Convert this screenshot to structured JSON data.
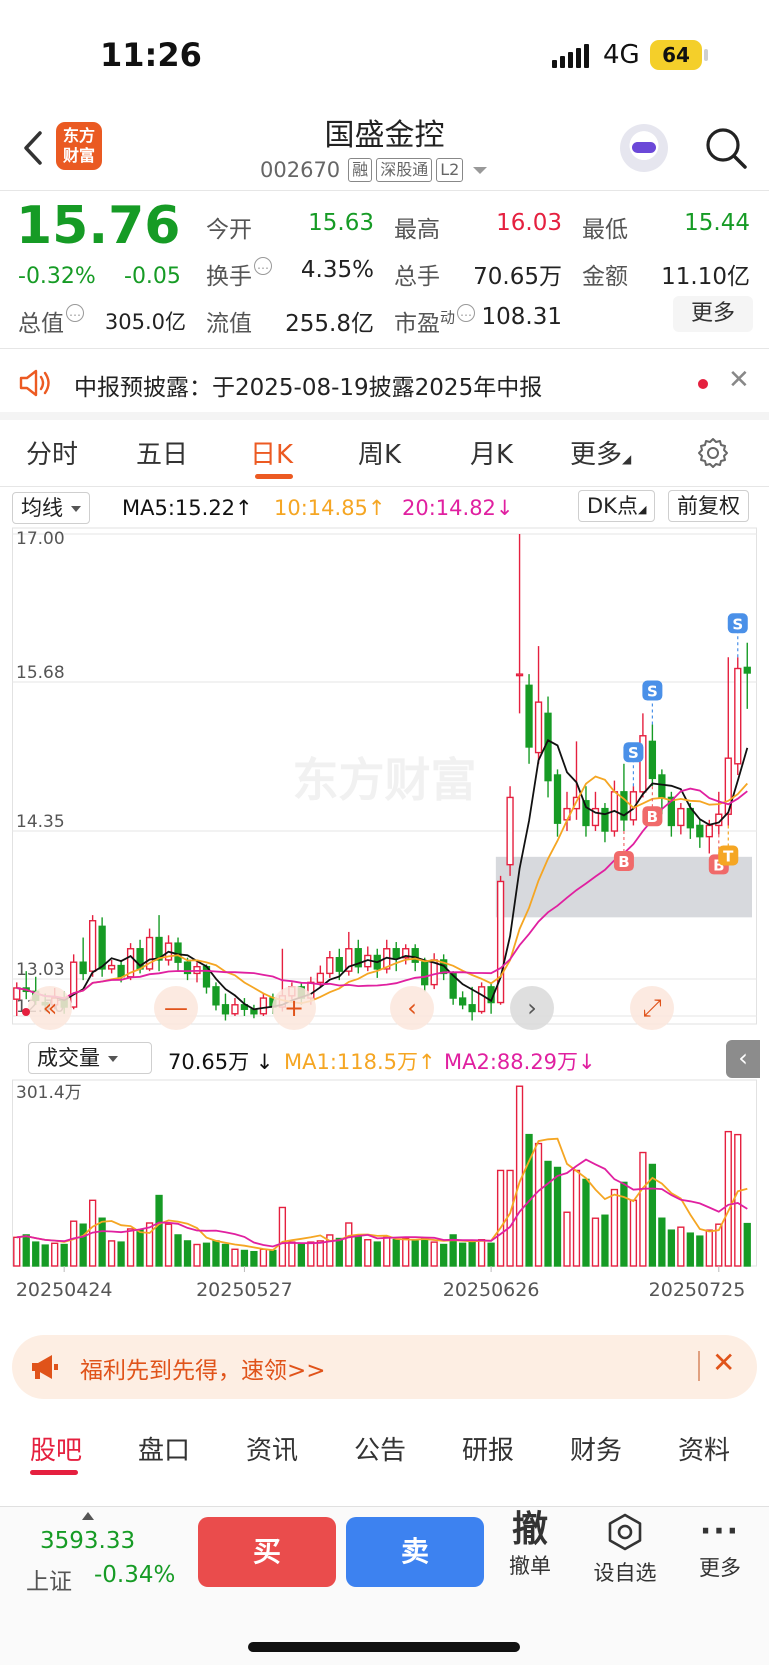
{
  "status": {
    "time": "11:26",
    "network": "4G",
    "battery": "64"
  },
  "header": {
    "logo": "东方\n财富",
    "stock_name": "国盛金控",
    "stock_code": "002670",
    "tags": [
      "融",
      "深股通",
      "L2"
    ]
  },
  "quote": {
    "price": "15.76",
    "change_pct": "-0.32%",
    "change_abs": "-0.05",
    "open_label": "今开",
    "open": "15.63",
    "high_label": "最高",
    "high": "16.03",
    "low_label": "最低",
    "low": "15.44",
    "turnover_label": "换手",
    "turnover": "4.35%",
    "volume_label": "总手",
    "volume": "70.65万",
    "amount_label": "金额",
    "amount": "11.10亿",
    "mktcap_label": "总值",
    "mktcap": "305.0亿",
    "float_label": "流值",
    "float_cap": "255.8亿",
    "pe_label": "市盈",
    "pe_sup": "动",
    "pe": "108.31",
    "more": "更多"
  },
  "notice": {
    "text": "中报预披露：于2025-08-19披露2025年中报"
  },
  "tabs": [
    "分时",
    "五日",
    "日K",
    "周K",
    "月K",
    "更多"
  ],
  "active_tab": "日K",
  "chart_toolbar": {
    "indicator": "均线",
    "ma5": "MA5:15.22",
    "ma10": "10:14.85",
    "ma20": "20:14.82",
    "dk": "DK点",
    "adjust": "前复权"
  },
  "volume_toolbar": {
    "indicator": "成交量",
    "vol": "70.65万",
    "ma1": "MA1:118.5万",
    "ma2": "MA2:88.29万"
  },
  "colors": {
    "up": "#e5203f",
    "down": "#169b25",
    "ma5": "#111111",
    "ma10": "#f5a623",
    "ma20": "#e020a0",
    "accent": "#ec5a22"
  },
  "chart_data": {
    "type": "candlestick",
    "price_axis": {
      "ylim": [
        12.7,
        17.0
      ],
      "ticks": [
        "17.00",
        "15.68",
        "14.35",
        "13.03",
        "12.70"
      ]
    },
    "volume_axis": {
      "max_label": "301.4万",
      "ylim": [
        0,
        301.4
      ]
    },
    "x_labels": [
      "20250424",
      "20250527",
      "20250626",
      "20250725"
    ],
    "candles": [
      [
        12.85,
        12.95,
        12.7,
        13.0,
        48
      ],
      [
        12.95,
        12.92,
        12.85,
        13.1,
        52
      ],
      [
        12.92,
        12.84,
        12.8,
        13.05,
        40
      ],
      [
        12.82,
        12.8,
        12.74,
        12.9,
        35
      ],
      [
        12.8,
        12.86,
        12.76,
        12.95,
        38
      ],
      [
        12.86,
        12.78,
        12.72,
        12.92,
        36
      ],
      [
        12.78,
        13.18,
        12.76,
        13.25,
        75
      ],
      [
        13.18,
        13.08,
        13.02,
        13.4,
        70
      ],
      [
        13.1,
        13.55,
        13.05,
        13.6,
        110
      ],
      [
        13.5,
        13.12,
        13.05,
        13.58,
        80
      ],
      [
        13.12,
        13.15,
        13.08,
        13.2,
        42
      ],
      [
        13.15,
        13.05,
        13.0,
        13.2,
        40
      ],
      [
        13.05,
        13.3,
        13.02,
        13.35,
        62
      ],
      [
        13.3,
        13.12,
        13.08,
        13.38,
        60
      ],
      [
        13.12,
        13.4,
        13.1,
        13.48,
        72
      ],
      [
        13.4,
        13.2,
        13.1,
        13.6,
        118
      ],
      [
        13.2,
        13.35,
        13.15,
        13.42,
        70
      ],
      [
        13.35,
        13.18,
        13.1,
        13.4,
        52
      ],
      [
        13.18,
        13.08,
        13.02,
        13.22,
        42
      ],
      [
        13.08,
        13.14,
        13.0,
        13.18,
        36
      ],
      [
        13.14,
        12.96,
        12.9,
        13.16,
        38
      ],
      [
        12.96,
        12.8,
        12.75,
        13.0,
        42
      ],
      [
        12.8,
        12.72,
        12.66,
        12.9,
        36
      ],
      [
        12.72,
        12.8,
        12.7,
        12.86,
        28
      ],
      [
        12.8,
        12.76,
        12.7,
        12.86,
        26
      ],
      [
        12.76,
        12.72,
        12.68,
        12.8,
        24
      ],
      [
        12.72,
        12.86,
        12.7,
        12.9,
        28
      ],
      [
        12.86,
        12.78,
        12.72,
        12.9,
        26
      ],
      [
        12.78,
        12.88,
        12.74,
        13.3,
        98
      ],
      [
        12.88,
        12.96,
        12.85,
        13.0,
        40
      ],
      [
        12.96,
        12.86,
        12.8,
        13.0,
        36
      ],
      [
        12.86,
        13.0,
        12.8,
        13.05,
        40
      ],
      [
        13.0,
        13.08,
        12.95,
        13.15,
        42
      ],
      [
        13.08,
        13.22,
        13.04,
        13.28,
        52
      ],
      [
        13.22,
        13.1,
        13.02,
        13.3,
        46
      ],
      [
        13.1,
        13.3,
        13.06,
        13.45,
        72
      ],
      [
        13.3,
        13.14,
        13.08,
        13.38,
        50
      ],
      [
        13.14,
        13.24,
        13.1,
        13.32,
        44
      ],
      [
        13.24,
        13.12,
        13.04,
        13.3,
        40
      ],
      [
        13.12,
        13.3,
        13.08,
        13.38,
        48
      ],
      [
        13.3,
        13.22,
        13.1,
        13.36,
        44
      ],
      [
        13.22,
        13.3,
        13.16,
        13.34,
        46
      ],
      [
        13.3,
        13.18,
        13.1,
        13.34,
        42
      ],
      [
        13.18,
        12.98,
        12.92,
        13.22,
        46
      ],
      [
        12.98,
        13.2,
        12.94,
        13.26,
        40
      ],
      [
        13.2,
        13.08,
        13.02,
        13.25,
        36
      ],
      [
        13.08,
        12.86,
        12.8,
        13.1,
        52
      ],
      [
        12.86,
        12.8,
        12.76,
        12.92,
        38
      ],
      [
        12.8,
        12.74,
        12.66,
        12.96,
        40
      ],
      [
        12.74,
        12.96,
        12.72,
        13.0,
        44
      ],
      [
        12.96,
        12.82,
        12.72,
        13.0,
        38
      ],
      [
        12.82,
        13.9,
        12.8,
        13.95,
        160
      ],
      [
        14.05,
        14.65,
        13.95,
        14.75,
        160
      ],
      [
        15.75,
        15.75,
        15.4,
        17.0,
        301
      ],
      [
        15.65,
        15.1,
        14.95,
        15.75,
        220
      ],
      [
        15.05,
        15.5,
        14.95,
        16.0,
        205
      ],
      [
        15.4,
        14.8,
        14.65,
        15.55,
        175
      ],
      [
        14.85,
        14.42,
        14.3,
        14.9,
        165
      ],
      [
        14.45,
        14.55,
        14.35,
        14.7,
        90
      ],
      [
        14.55,
        14.65,
        14.45,
        15.15,
        160
      ],
      [
        14.62,
        14.4,
        14.3,
        14.75,
        145
      ],
      [
        14.4,
        14.55,
        14.35,
        14.7,
        80
      ],
      [
        14.55,
        14.35,
        14.25,
        14.6,
        85
      ],
      [
        14.35,
        14.7,
        14.3,
        14.8,
        128
      ],
      [
        14.7,
        14.45,
        14.35,
        14.95,
        140
      ],
      [
        14.45,
        14.7,
        14.4,
        14.75,
        110
      ],
      [
        14.7,
        15.2,
        14.65,
        15.4,
        190
      ],
      [
        15.15,
        14.82,
        14.75,
        15.3,
        170
      ],
      [
        14.85,
        14.65,
        14.5,
        14.9,
        80
      ],
      [
        14.65,
        14.4,
        14.3,
        14.7,
        60
      ],
      [
        14.4,
        14.55,
        14.32,
        14.6,
        65
      ],
      [
        14.55,
        14.38,
        14.28,
        14.6,
        55
      ],
      [
        14.4,
        14.3,
        14.2,
        14.45,
        50
      ],
      [
        14.3,
        14.4,
        14.15,
        14.45,
        60
      ],
      [
        14.4,
        14.5,
        14.32,
        14.7,
        70
      ],
      [
        14.5,
        15.0,
        14.4,
        15.9,
        225
      ],
      [
        14.95,
        15.8,
        14.85,
        15.9,
        220
      ],
      [
        15.81,
        15.76,
        15.44,
        16.03,
        71
      ]
    ],
    "ma5_label": "MA5",
    "ma10_label": "MA10",
    "ma20_label": "MA20",
    "signals": [
      {
        "label": "B",
        "index": 64
      },
      {
        "label": "S",
        "index": 65
      },
      {
        "label": "B",
        "index": 67
      },
      {
        "label": "S",
        "index": 67
      },
      {
        "label": "B",
        "index": 74
      },
      {
        "label": "T",
        "index": 75
      },
      {
        "label": "S",
        "index": 76
      }
    ],
    "range_box": {
      "from_index": 51,
      "ylim": [
        13.58,
        14.12
      ]
    },
    "watermark": "东方财富"
  },
  "banner": {
    "text": "福利先到先得，速领>>"
  },
  "bottom_tabs": [
    "股吧",
    "盘口",
    "资讯",
    "公告",
    "研报",
    "财务",
    "资料"
  ],
  "footer": {
    "index_value": "3593.33",
    "index_name": "上证",
    "index_change": "-0.34%",
    "buy": "买",
    "sell": "卖",
    "cancel_icon": "撤",
    "cancel": "撤单",
    "watchlist": "设自选",
    "more": "更多"
  }
}
